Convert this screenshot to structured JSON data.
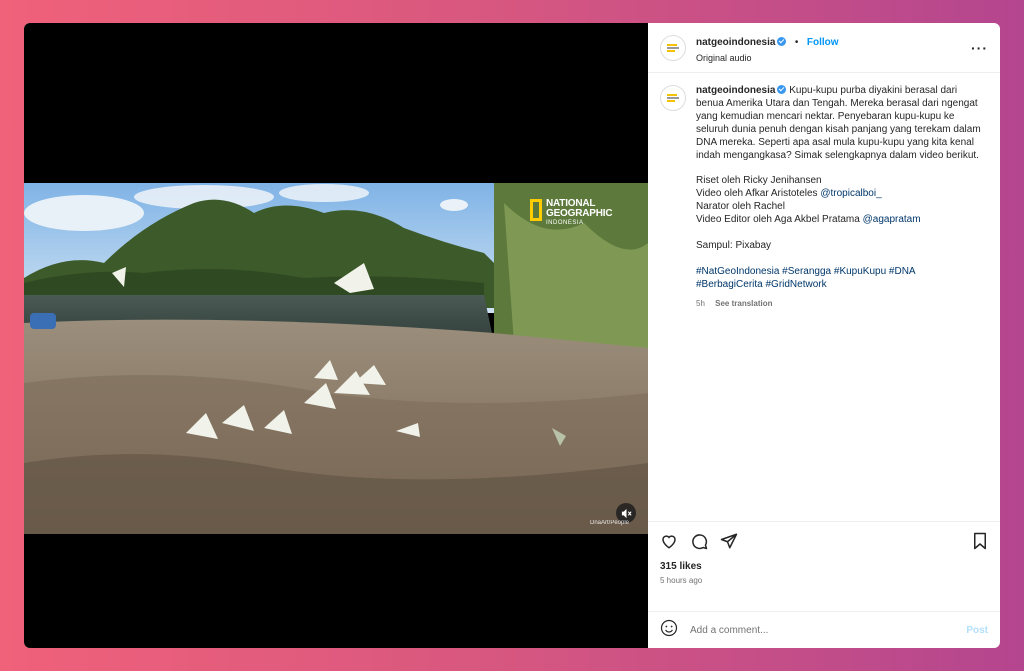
{
  "colors": {
    "accent": "#0095f6",
    "background_left": "#f0617a",
    "background_right": "#b4468f"
  },
  "header": {
    "username": "natgeoindonesia",
    "verified": true,
    "separator": "•",
    "follow_label": "Follow",
    "audio": "Original audio",
    "more_icon": "more-horizontal-icon"
  },
  "video": {
    "watermark": {
      "line1": "NATIONAL",
      "line2": "GEOGRAPHIC",
      "line3": "INDONESIA"
    },
    "credit": "DnaArt/People",
    "mute_icon": "speaker-muted-icon"
  },
  "caption": {
    "username": "natgeoindonesia",
    "text": "Kupu-kupu purba diyakini berasal dari benua Amerika Utara dan Tengah. Mereka berasal dari ngengat yang kemudian mencari nektar. Penyebaran kupu-kupu ke seluruh dunia penuh dengan kisah panjang yang terekam dalam DNA mereka. Seperti apa asal mula kupu-kupu yang kita kenal indah mengangkasa? Simak selengkapnya dalam video berikut.",
    "credits": {
      "research": "Riset oleh Ricky Jenihansen",
      "video_prefix": "Video oleh Afkar Aristoteles",
      "video_handle": "@tropicalboi_",
      "narrator": "Narator oleh Rachel",
      "editor_prefix": "Video Editor oleh Aga Akbel Pratama",
      "editor_handle": "@agapratam"
    },
    "cover": "Sampul: Pixabay",
    "hashtags_line1": "#NatGeoIndonesia #Serangga #KupuKupu #DNA",
    "hashtags_line2": "#BerbagiCerita #GridNetwork",
    "time": "5h",
    "see_translation": "See translation"
  },
  "actions": {
    "icons": [
      "heart-icon",
      "comment-icon",
      "share-icon",
      "bookmark-icon"
    ],
    "likes": "315 likes",
    "posted": "5 hours ago"
  },
  "composer": {
    "emoji_icon": "emoji-icon",
    "placeholder": "Add a comment...",
    "post_label": "Post"
  }
}
